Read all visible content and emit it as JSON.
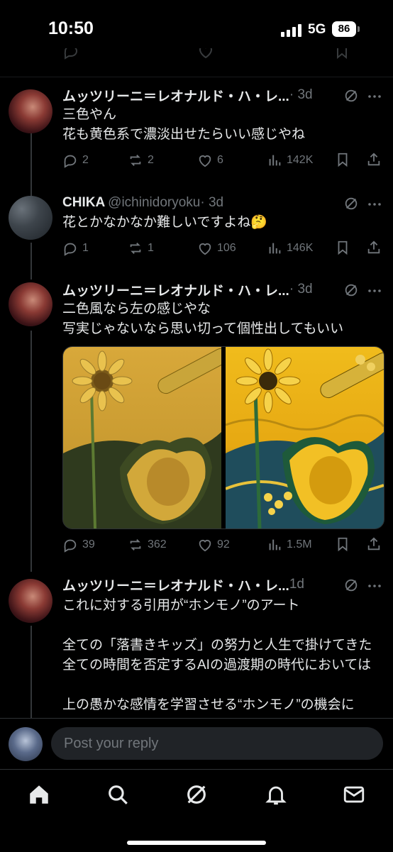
{
  "status": {
    "time": "10:50",
    "network": "5G",
    "battery": "86"
  },
  "composer": {
    "placeholder": "Post your reply"
  },
  "tweets": [
    {
      "name": "ムッツリーニ＝レオナルド・ハ・レ...",
      "handle": "",
      "time": "· 3d",
      "text": "三色やん\n花も黄色系で濃淡出せたらいい感じやね",
      "replies": "2",
      "reposts": "2",
      "likes": "6",
      "views": "142K"
    },
    {
      "name": "CHIKA",
      "handle": "@ichinidoryoku",
      "time": " · 3d",
      "text": "花とかなかなか難しいですよね🤔",
      "replies": "1",
      "reposts": "1",
      "likes": "106",
      "views": "146K"
    },
    {
      "name": "ムッツリーニ＝レオナルド・ハ・レ...",
      "handle": "",
      "time": "· 3d",
      "text": "二色風なら左の感じやな\n写実じゃないなら思い切って個性出してもいい",
      "replies": "39",
      "reposts": "362",
      "likes": "92",
      "views": "1.5M"
    },
    {
      "name": "ムッツリーニ＝レオナルド・ハ・レ...",
      "handle": "",
      "time": "1d",
      "text": "これに対する引用が“ホンモノ”のアート\n\n全ての「落書きキッズ」の努力と人生で掛けてきた全ての時間を否定するAIの過渡期の時代においては\n\n上の愚かな感情を学習させる“ホンモノ”の機会に"
    }
  ],
  "colors": {
    "text": "#e7e9ea",
    "muted": "#71767b",
    "divider": "#2f3336",
    "bg": "#000000"
  },
  "icons": {
    "tabs": [
      "home-icon",
      "search-icon",
      "grok-icon",
      "notifications-icon",
      "messages-icon"
    ]
  }
}
